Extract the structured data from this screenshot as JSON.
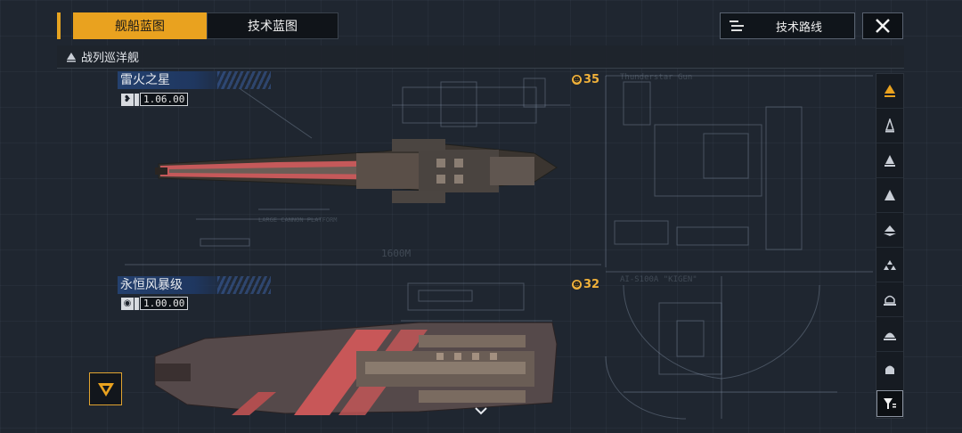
{
  "tabs": [
    {
      "label": "舰船蓝图",
      "active": true
    },
    {
      "label": "技术蓝图",
      "active": false
    }
  ],
  "route_button": {
    "label": "技术路线",
    "icon": "list-tree-icon"
  },
  "close_button": {
    "icon": "close-icon"
  },
  "category": {
    "label": "战列巡洋舰",
    "icon": "ship-class-icon"
  },
  "ships": [
    {
      "name": "雷火之星",
      "class_icon": "weapon-type-icon",
      "version": "1.06.00",
      "cost": "35"
    },
    {
      "name": "永恒风暴级",
      "class_icon": "weapon-type-icon",
      "version": "1.00.00",
      "cost": "32"
    }
  ],
  "blueprint_text": {
    "t1": "Thunderstar Gun",
    "t2": "1600M",
    "t3": "AI-S100A \"KIGEN\"",
    "t4": "LARGE CANNON PLATFORM"
  },
  "side_nav": [
    {
      "icon": "battlecruiser-icon",
      "active": true
    },
    {
      "icon": "frigate-icon",
      "active": false
    },
    {
      "icon": "destroyer-icon",
      "active": false
    },
    {
      "icon": "cruiser-icon",
      "active": false
    },
    {
      "icon": "carrier-icon",
      "active": false
    },
    {
      "icon": "fighter-squadron-icon",
      "active": false
    },
    {
      "icon": "corvette-icon",
      "active": false
    },
    {
      "icon": "auxiliary-ship-icon",
      "active": false
    },
    {
      "icon": "station-icon",
      "active": false
    }
  ],
  "colors": {
    "accent": "#e9a21f",
    "ship_hull_highlight": "#e8605d",
    "panel_blue": "#24406e"
  }
}
